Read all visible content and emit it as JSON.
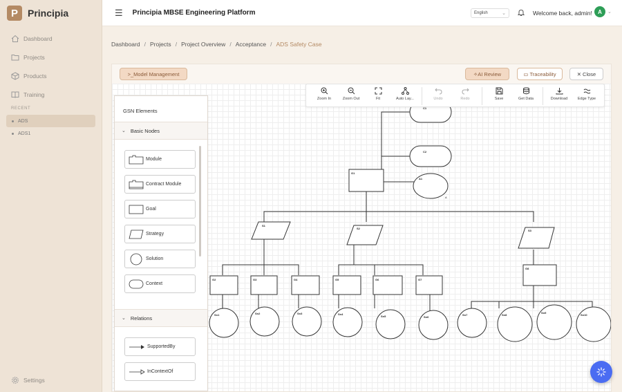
{
  "app": {
    "name": "Principia",
    "logo_letter": "P",
    "platform_title": "Principia MBSE Engineering Platform"
  },
  "sidebar": {
    "nav": [
      {
        "label": "Dashboard",
        "icon": "home-icon"
      },
      {
        "label": "Projects",
        "icon": "folder-icon"
      },
      {
        "label": "Products",
        "icon": "box-icon"
      },
      {
        "label": "Training",
        "icon": "book-icon"
      }
    ],
    "recent_label": "RECENT",
    "recent": [
      {
        "label": "ADS",
        "active": true
      },
      {
        "label": "ADS1",
        "active": false
      }
    ],
    "settings_label": "Settings"
  },
  "header": {
    "language": "English",
    "welcome": "Welcome back, admin!",
    "avatar_letter": "A"
  },
  "breadcrumb": [
    "Dashboard",
    "Projects",
    "Project Overview",
    "Acceptance",
    "ADS Safety Case"
  ],
  "workspace": {
    "model_management": ">_Model Management",
    "ai_review": "AI Review",
    "traceability": "Traceability",
    "close": "Close"
  },
  "palette": {
    "title": "GSN Elements",
    "basic_nodes_label": "Basic Nodes",
    "basic_nodes": [
      "Module",
      "Contract Module",
      "Goal",
      "Strategy",
      "Solution",
      "Context"
    ],
    "relations_label": "Relations",
    "relations": [
      "SupportedBy",
      "InContextOf"
    ]
  },
  "toolbar": {
    "zoom_in": "Zoom In",
    "zoom_out": "Zoom Out",
    "fit": "Fit",
    "auto_layout": "Auto Lay...",
    "undo": "Undo",
    "redo": "Redo",
    "save": "Save",
    "get_data": "Get Data",
    "download": "Download",
    "edge_type": "Edge Type"
  },
  "diagram": {
    "top_goal": "G1",
    "contexts": [
      "C1",
      "C2"
    ],
    "assumption": "A1",
    "assumption_marker": "A",
    "strategies": [
      "S1",
      "S2",
      "S3"
    ],
    "sub_goals": [
      "G2",
      "G3",
      "G4",
      "G5",
      "G6",
      "G7",
      "G8"
    ],
    "solutions": [
      "Sn1",
      "Sn2",
      "Sn3",
      "Sn4",
      "Sn5",
      "Sn6",
      "Sn7",
      "Sn8",
      "Sn9",
      "Sn10"
    ]
  },
  "colors": {
    "accent": "#b48a64",
    "primary_button": "#f3d9c4",
    "fab": "#4a6cf2",
    "avatar": "#2e9e57"
  }
}
